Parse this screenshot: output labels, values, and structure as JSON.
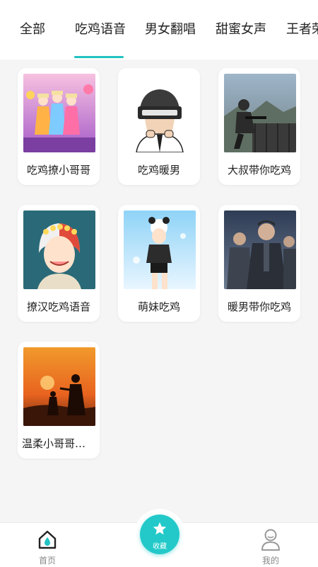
{
  "tabs": [
    {
      "label": "全部"
    },
    {
      "label": "吃鸡语音"
    },
    {
      "label": "男女翻唱"
    },
    {
      "label": "甜蜜女声"
    },
    {
      "label": "王者荣"
    }
  ],
  "active_tab_index": 1,
  "accent_color": "#23c3c3",
  "cards": [
    {
      "label": "吃鸡撩小哥哥"
    },
    {
      "label": "吃鸡暖男"
    },
    {
      "label": "大叔带你吃鸡"
    },
    {
      "label": "撩汉吃鸡语音"
    },
    {
      "label": "萌妹吃鸡"
    },
    {
      "label": "暖男带你吃鸡"
    },
    {
      "label": "温柔小哥哥吃..."
    }
  ],
  "bottom_nav": {
    "home_label": "首页",
    "favorites_label": "收藏",
    "mine_label": "我的"
  }
}
